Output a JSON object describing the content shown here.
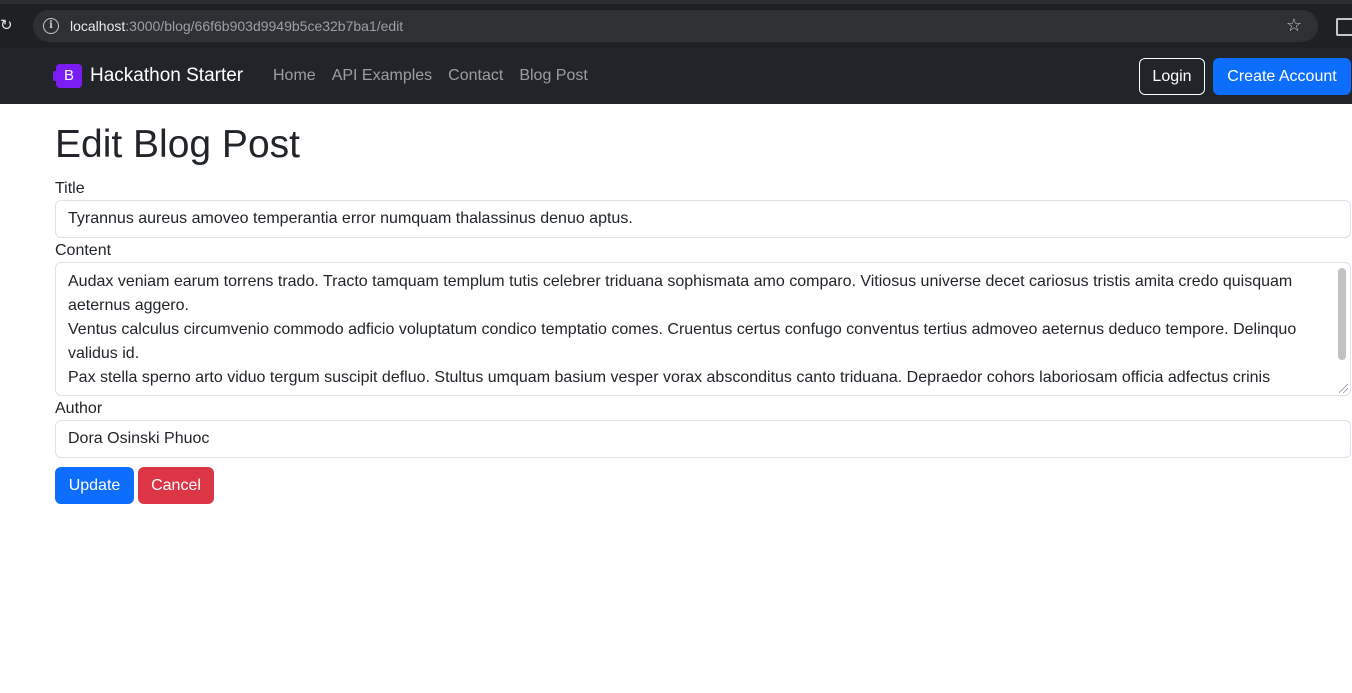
{
  "browser": {
    "url_host": "localhost",
    "url_path": ":3000/blog/66f6b903d9949b5ce32b7ba1/edit",
    "icons": {
      "reload": "reload-icon",
      "info": "info-icon",
      "bookmark": "star-icon",
      "extension": "extension-icon"
    }
  },
  "navbar": {
    "logo_letter": "B",
    "brand": "Hackathon Starter",
    "links": [
      {
        "label": "Home"
      },
      {
        "label": "API Examples"
      },
      {
        "label": "Contact"
      },
      {
        "label": "Blog Post"
      }
    ],
    "login_label": "Login",
    "create_account_label": "Create Account",
    "colors": {
      "background": "#212529",
      "logo": "#7a1cf4",
      "primary": "#0d6efd"
    }
  },
  "form": {
    "heading": "Edit Blog Post",
    "title_label": "Title",
    "title_value": "Tyrannus aureus amoveo temperantia error numquam thalassinus denuo aptus.",
    "content_label": "Content",
    "content_paragraphs": [
      "Audax veniam earum torrens trado. Tracto tamquam templum tutis celebrer triduana sophismata amo comparo. Vitiosus universe decet cariosus tristis amita credo quisquam aeternus aggero.",
      "Ventus calculus circumvenio commodo adficio voluptatum condico temptatio comes. Cruentus certus confugo conventus tertius admoveo aeternus deduco tempore. Delinquo validus id.",
      "Pax stella sperno arto viduo tergum suscipit defluo. Stultus umquam basium vesper vorax absconditus canto triduana. Depraedor cohors laboriosam officia adfectus crinis"
    ],
    "author_label": "Author",
    "author_value": "Dora Osinski Phuoc",
    "update_label": "Update",
    "cancel_label": "Cancel",
    "colors": {
      "update": "#0d6efd",
      "cancel": "#dc3545"
    }
  }
}
